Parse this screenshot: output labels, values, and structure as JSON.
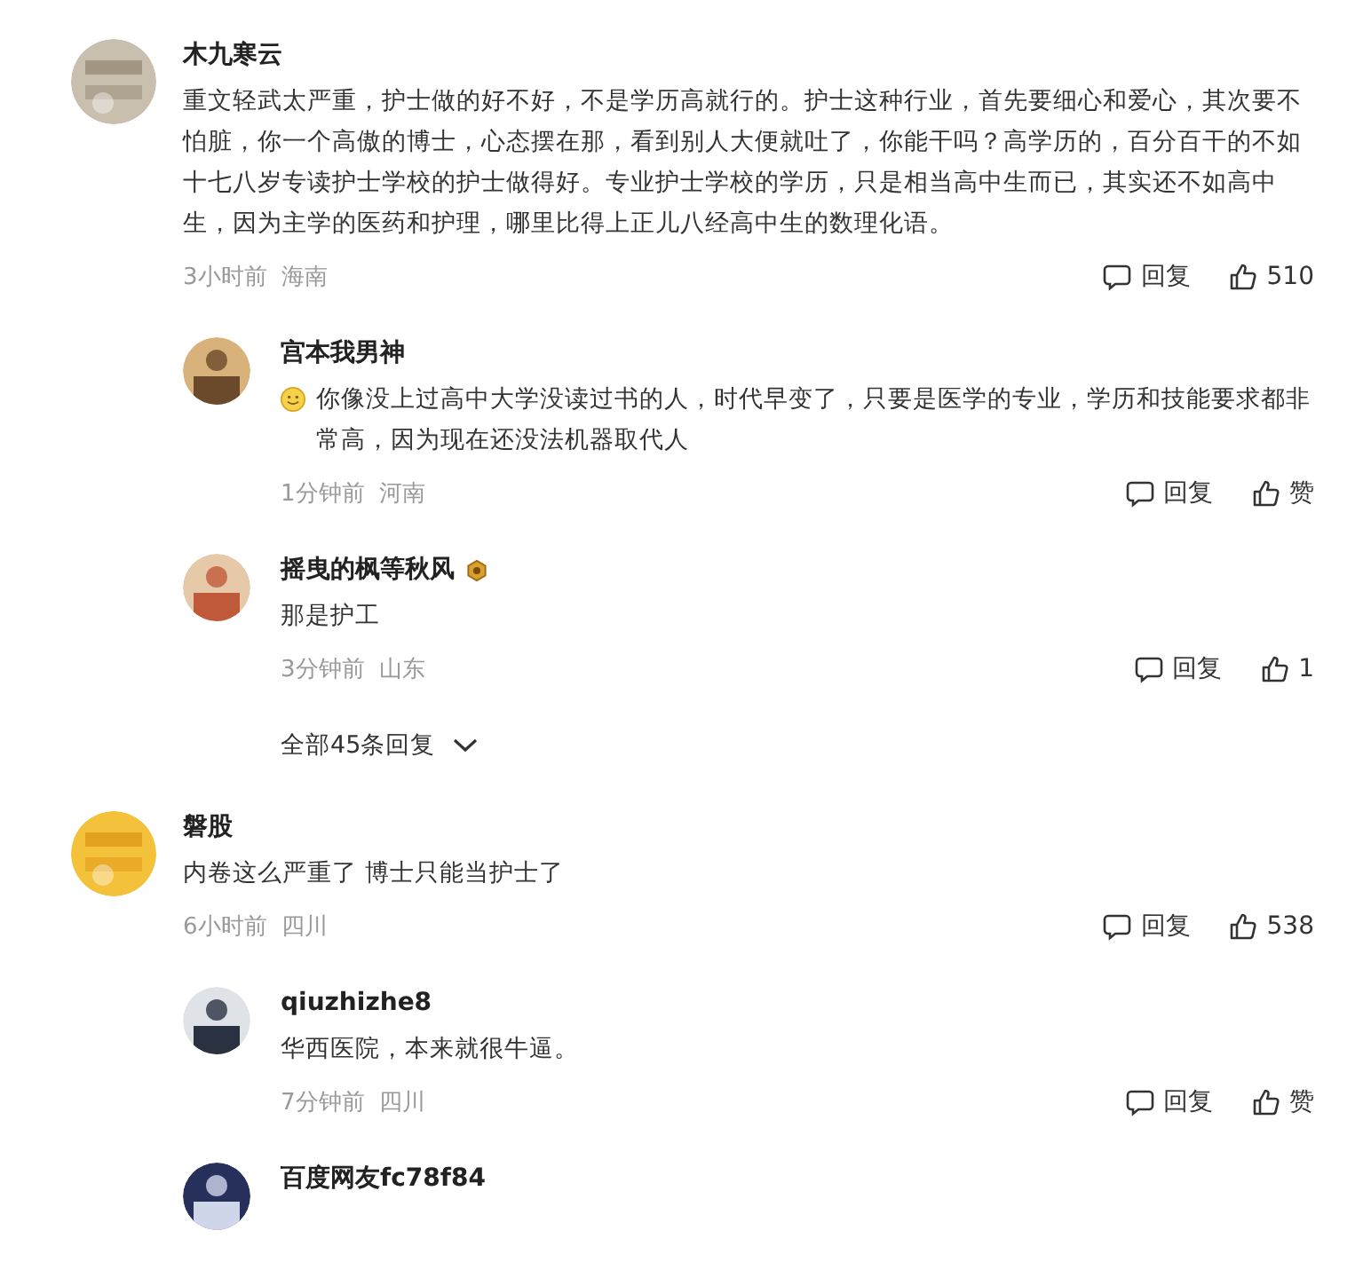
{
  "comments": [
    {
      "name": "木九寒云",
      "text": "重文轻武太严重，护士做的好不好，不是学历高就行的。护士这种行业，首先要细心和爱心，其次要不怕脏，你一个高傲的博士，心态摆在那，看到别人大便就吐了，你能干吗？高学历的，百分百干的不如十七八岁专读护士学校的护士做得好。专业护士学校的学历，只是相当高中生而已，其实还不如高中生，因为主学的医药和护理，哪里比得上正儿八经高中生的数理化语。",
      "time": "3小时前",
      "location": "海南",
      "reply_label": "回复",
      "likes": "510",
      "replies": [
        {
          "name": "宫本我男神",
          "emoji": true,
          "badge": false,
          "text": "你像没上过高中大学没读过书的人，时代早变了，只要是医学的专业，学历和技能要求都非常高，因为现在还没法机器取代人",
          "time": "1分钟前",
          "location": "河南",
          "reply_label": "回复",
          "likes": "赞"
        },
        {
          "name": "摇曳的枫等秋风",
          "emoji": false,
          "badge": true,
          "text": "那是护工",
          "time": "3分钟前",
          "location": "山东",
          "reply_label": "回复",
          "likes": "1"
        }
      ],
      "more_replies": "全部45条回复"
    },
    {
      "name": "磐股",
      "text": "内卷这么严重了  博士只能当护士了",
      "time": "6小时前",
      "location": "四川",
      "reply_label": "回复",
      "likes": "538",
      "replies": [
        {
          "name": "qiuzhizhe8",
          "emoji": false,
          "badge": false,
          "text": "华西医院，本来就很牛逼。",
          "time": "7分钟前",
          "location": "四川",
          "reply_label": "回复",
          "likes": "赞"
        },
        {
          "name": "百度网友fc78f84",
          "emoji": false,
          "badge": false
        }
      ]
    }
  ]
}
